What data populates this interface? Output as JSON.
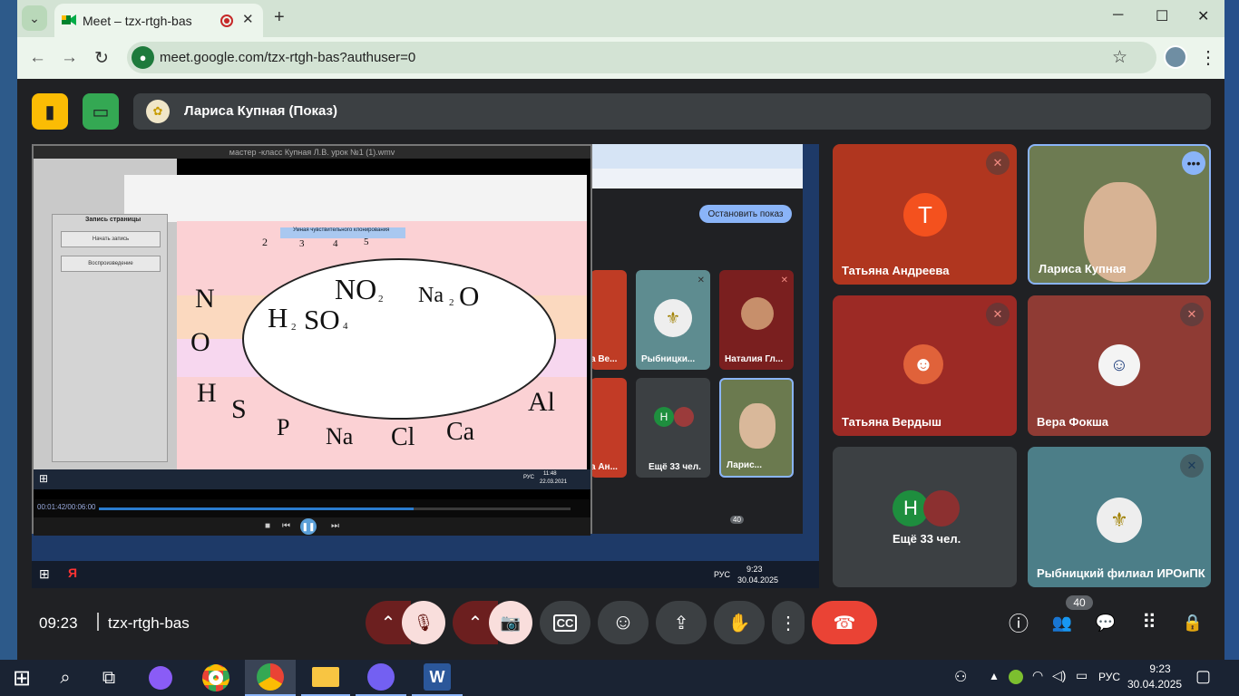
{
  "browser": {
    "tab_title": "Meet – tzx-rtgh-bas",
    "tab_menu_icon": "⌄",
    "tab_close": "✕",
    "new_tab": "+",
    "window_controls": {
      "minimize": "─",
      "maximize": "☐",
      "close": "✕"
    },
    "back": "←",
    "forward": "→",
    "reload": "↻",
    "url": "meet.google.com/tzx-rtgh-bas?authuser=0",
    "star": "☆",
    "menu": "⋮"
  },
  "meet": {
    "presenter_bar": "Лариса Купная (Показ)",
    "shared_screen": {
      "player_title": "мастер -класс Купная Л.В. урок №1 (1).wmv",
      "recording_panel_title": "Запись страницы",
      "start_recording": "Начать запись",
      "playback": "Воспроизведение",
      "clipboard_tooltip": "Умная чувствительного клонирования",
      "slide_numbers": [
        "2",
        "3",
        "4",
        "5"
      ],
      "elements": [
        "N",
        "O",
        "H",
        "S",
        "P",
        "Na",
        "Cl",
        "Ca",
        "Al"
      ],
      "formulas": {
        "no2": "NO",
        "no2_sub": "2",
        "na2o_na": "Na",
        "na2o_sub": "2",
        "na2o_o": "O",
        "h2so4_h": "H",
        "h2so4_sub2": "2",
        "h2so4_so": "SO",
        "h2so4_sub4": "4"
      },
      "player_time": "00:01:42/00:06:00",
      "inner_clock_time": "11:48",
      "inner_clock_date": "22.03.2021",
      "inner_lang": "РУС",
      "stop_presenting": "Остановить показ",
      "mini_tiles": [
        {
          "name": "а Ве..."
        },
        {
          "name": "Рыбницки..."
        },
        {
          "name": "Наталия Гл..."
        },
        {
          "name": "а Ан..."
        },
        {
          "name": "Ещё 33 чел."
        },
        {
          "name": "Ларис..."
        }
      ],
      "desktop_clock_time": "9:23",
      "desktop_clock_date": "30.04.2025",
      "desktop_lang": "РУС",
      "inner_count": "40",
      "inner_time": "09:23",
      "inner_code": "tzx-rtgh-bas"
    },
    "tiles": [
      {
        "name": "Татьяна Андреева",
        "initial": "Т"
      },
      {
        "name": "Лариса Купная"
      },
      {
        "name": "Татьяна Вердыш"
      },
      {
        "name": "Вера Фокша"
      },
      {
        "name": "Ещё 33 чел.",
        "initial": "Н"
      },
      {
        "name": "Рыбницкий филиал ИРОиПК"
      }
    ],
    "time": "09:23",
    "meeting_code": "tzx-rtgh-bas",
    "participant_count": "40",
    "icons": {
      "chevron_up": "⌃",
      "mic_off": "🎙",
      "camera_off": "📷",
      "captions": "CC",
      "emoji": "☺",
      "present": "⇪",
      "hand": "✋",
      "more": "⋮",
      "hangup": "☎",
      "info": "ⓘ",
      "people": "👥",
      "chat": "💬",
      "activities": "⠿",
      "lock": "🔒"
    },
    "colors": {
      "hangup": "#ea4335",
      "mic_off_bg": "#f9dedc",
      "accent": "#8ab4f8"
    }
  },
  "taskbar": {
    "start": "⊞",
    "search": "⌕",
    "task_view": "⧉",
    "lang": "РУС",
    "time": "9:23",
    "date": "30.04.2025",
    "notification": "▢"
  }
}
